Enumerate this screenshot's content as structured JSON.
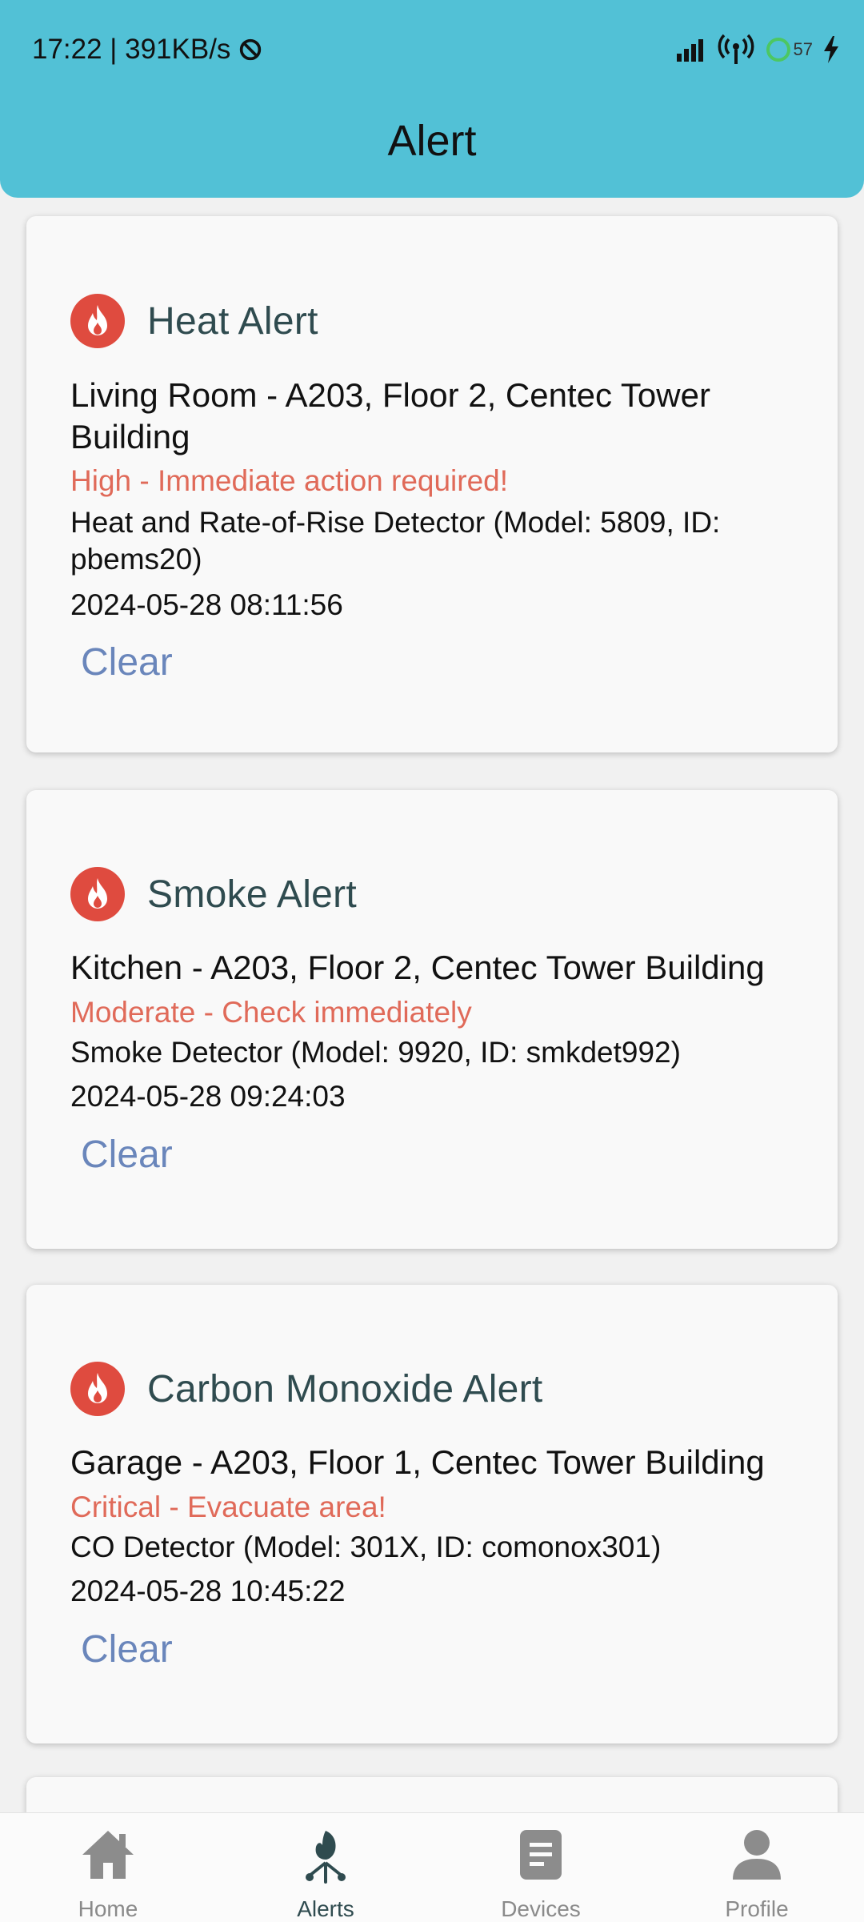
{
  "status_bar": {
    "time": "17:22 | 391KB/s",
    "battery": "57"
  },
  "header": {
    "title": "Alert"
  },
  "alerts": [
    {
      "title": "Heat Alert",
      "location": "Living Room - A203, Floor 2, Centec Tower Building",
      "severity": "High - Immediate action required!",
      "device": "Heat and Rate-of-Rise Detector (Model: 5809, ID: pbems20)",
      "timestamp": "2024-05-28 08:11:56",
      "action": "Clear"
    },
    {
      "title": "Smoke Alert",
      "location": "Kitchen - A203, Floor 2, Centec Tower Building",
      "severity": "Moderate - Check immediately",
      "device": "Smoke Detector (Model: 9920, ID: smkdet992)",
      "timestamp": "2024-05-28 09:24:03",
      "action": "Clear"
    },
    {
      "title": "Carbon Monoxide Alert",
      "location": "Garage - A203, Floor 1, Centec Tower Building",
      "severity": "Critical - Evacuate area!",
      "device": "CO Detector (Model: 301X, ID: comonox301)",
      "timestamp": "2024-05-28 10:45:22",
      "action": "Clear"
    }
  ],
  "bottom_nav": [
    {
      "label": "Home",
      "icon": "home-icon",
      "active": false
    },
    {
      "label": "Alerts",
      "icon": "alerts-icon",
      "active": true
    },
    {
      "label": "Devices",
      "icon": "devices-icon",
      "active": false
    },
    {
      "label": "Profile",
      "icon": "profile-icon",
      "active": false
    }
  ],
  "colors": {
    "header": "#52c1d6",
    "alert_icon": "#df4b3f",
    "severity_text": "#e06a59",
    "clear_button": "#6a86bb",
    "title_text": "#2f4b4f"
  }
}
